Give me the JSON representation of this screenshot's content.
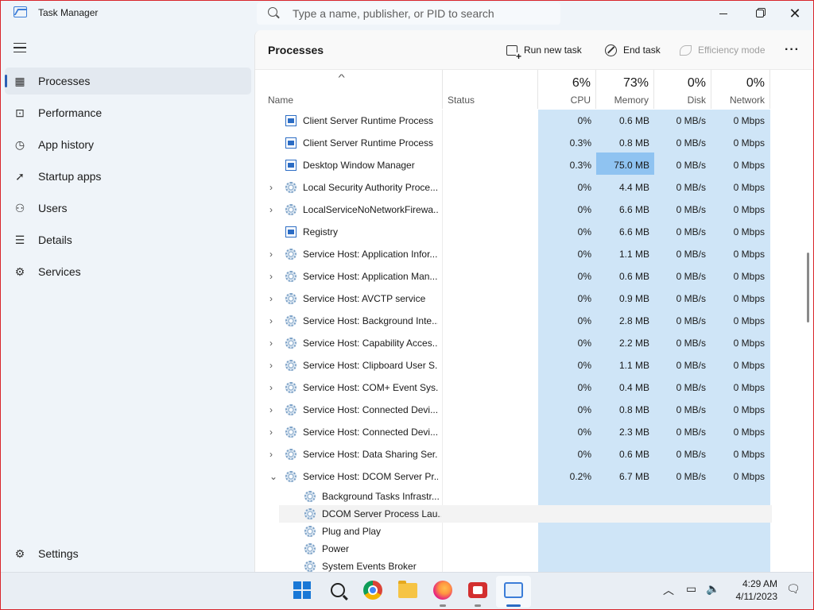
{
  "window": {
    "title": "Task Manager"
  },
  "search": {
    "placeholder": "Type a name, publisher, or PID to search"
  },
  "sidebar": {
    "items": [
      {
        "label": "Processes",
        "icon": "processes-icon"
      },
      {
        "label": "Performance",
        "icon": "performance-icon"
      },
      {
        "label": "App history",
        "icon": "app-history-icon"
      },
      {
        "label": "Startup apps",
        "icon": "startup-icon"
      },
      {
        "label": "Users",
        "icon": "users-icon"
      },
      {
        "label": "Details",
        "icon": "details-icon"
      },
      {
        "label": "Services",
        "icon": "services-icon"
      }
    ],
    "settings_label": "Settings"
  },
  "header": {
    "title": "Processes",
    "run_new_task": "Run new task",
    "end_task": "End task",
    "efficiency_mode": "Efficiency mode"
  },
  "columns": {
    "name": "Name",
    "status": "Status",
    "cpu": {
      "pct": "6%",
      "label": "CPU"
    },
    "memory": {
      "pct": "73%",
      "label": "Memory"
    },
    "disk": {
      "pct": "0%",
      "label": "Disk"
    },
    "network": {
      "pct": "0%",
      "label": "Network"
    }
  },
  "rows": [
    {
      "name": "Client Server Runtime Process",
      "icon": "window",
      "expandable": false,
      "cpu": "0%",
      "memory": "0.6 MB",
      "disk": "0 MB/s",
      "network": "0 Mbps"
    },
    {
      "name": "Client Server Runtime Process",
      "icon": "window",
      "expandable": false,
      "cpu": "0.3%",
      "memory": "0.8 MB",
      "disk": "0 MB/s",
      "network": "0 Mbps"
    },
    {
      "name": "Desktop Window Manager",
      "icon": "window",
      "expandable": false,
      "cpu": "0.3%",
      "memory": "75.0 MB",
      "disk": "0 MB/s",
      "network": "0 Mbps"
    },
    {
      "name": "Local Security Authority Proce...",
      "icon": "gear",
      "expandable": true,
      "cpu": "0%",
      "memory": "4.4 MB",
      "disk": "0 MB/s",
      "network": "0 Mbps"
    },
    {
      "name": "LocalServiceNoNetworkFirewa...",
      "icon": "gear",
      "expandable": true,
      "cpu": "0%",
      "memory": "6.6 MB",
      "disk": "0 MB/s",
      "network": "0 Mbps"
    },
    {
      "name": "Registry",
      "icon": "window",
      "expandable": false,
      "cpu": "0%",
      "memory": "6.6 MB",
      "disk": "0 MB/s",
      "network": "0 Mbps"
    },
    {
      "name": "Service Host: Application Infor...",
      "icon": "gear",
      "expandable": true,
      "cpu": "0%",
      "memory": "1.1 MB",
      "disk": "0 MB/s",
      "network": "0 Mbps"
    },
    {
      "name": "Service Host: Application Man...",
      "icon": "gear",
      "expandable": true,
      "cpu": "0%",
      "memory": "0.6 MB",
      "disk": "0 MB/s",
      "network": "0 Mbps"
    },
    {
      "name": "Service Host: AVCTP service",
      "icon": "gear",
      "expandable": true,
      "cpu": "0%",
      "memory": "0.9 MB",
      "disk": "0 MB/s",
      "network": "0 Mbps"
    },
    {
      "name": "Service Host: Background Inte...",
      "icon": "gear",
      "expandable": true,
      "cpu": "0%",
      "memory": "2.8 MB",
      "disk": "0 MB/s",
      "network": "0 Mbps"
    },
    {
      "name": "Service Host: Capability Acces...",
      "icon": "gear",
      "expandable": true,
      "cpu": "0%",
      "memory": "2.2 MB",
      "disk": "0 MB/s",
      "network": "0 Mbps"
    },
    {
      "name": "Service Host: Clipboard User S...",
      "icon": "gear",
      "expandable": true,
      "cpu": "0%",
      "memory": "1.1 MB",
      "disk": "0 MB/s",
      "network": "0 Mbps"
    },
    {
      "name": "Service Host: COM+ Event Sys...",
      "icon": "gear",
      "expandable": true,
      "cpu": "0%",
      "memory": "0.4 MB",
      "disk": "0 MB/s",
      "network": "0 Mbps"
    },
    {
      "name": "Service Host: Connected Devi...",
      "icon": "gear",
      "expandable": true,
      "cpu": "0%",
      "memory": "0.8 MB",
      "disk": "0 MB/s",
      "network": "0 Mbps"
    },
    {
      "name": "Service Host: Connected Devi...",
      "icon": "gear",
      "expandable": true,
      "cpu": "0%",
      "memory": "2.3 MB",
      "disk": "0 MB/s",
      "network": "0 Mbps"
    },
    {
      "name": "Service Host: Data Sharing Ser...",
      "icon": "gear",
      "expandable": true,
      "cpu": "0%",
      "memory": "0.6 MB",
      "disk": "0 MB/s",
      "network": "0 Mbps"
    },
    {
      "name": "Service Host: DCOM Server Pr...",
      "icon": "gear",
      "expandable": true,
      "expanded": true,
      "cpu": "0.2%",
      "memory": "6.7 MB",
      "disk": "0 MB/s",
      "network": "0 Mbps"
    }
  ],
  "subrows": [
    {
      "name": "Background Tasks Infrastr..."
    },
    {
      "name": "DCOM Server Process Lau..."
    },
    {
      "name": "Plug and Play"
    },
    {
      "name": "Power"
    },
    {
      "name": "System Events Broker"
    }
  ],
  "taskbar": {
    "apps": [
      "start-icon",
      "search-icon",
      "chrome-icon",
      "file-explorer-icon",
      "firefox-icon",
      "screen-recorder-icon",
      "task-manager-icon"
    ],
    "time": "4:29 AM",
    "date": "4/11/2023"
  }
}
